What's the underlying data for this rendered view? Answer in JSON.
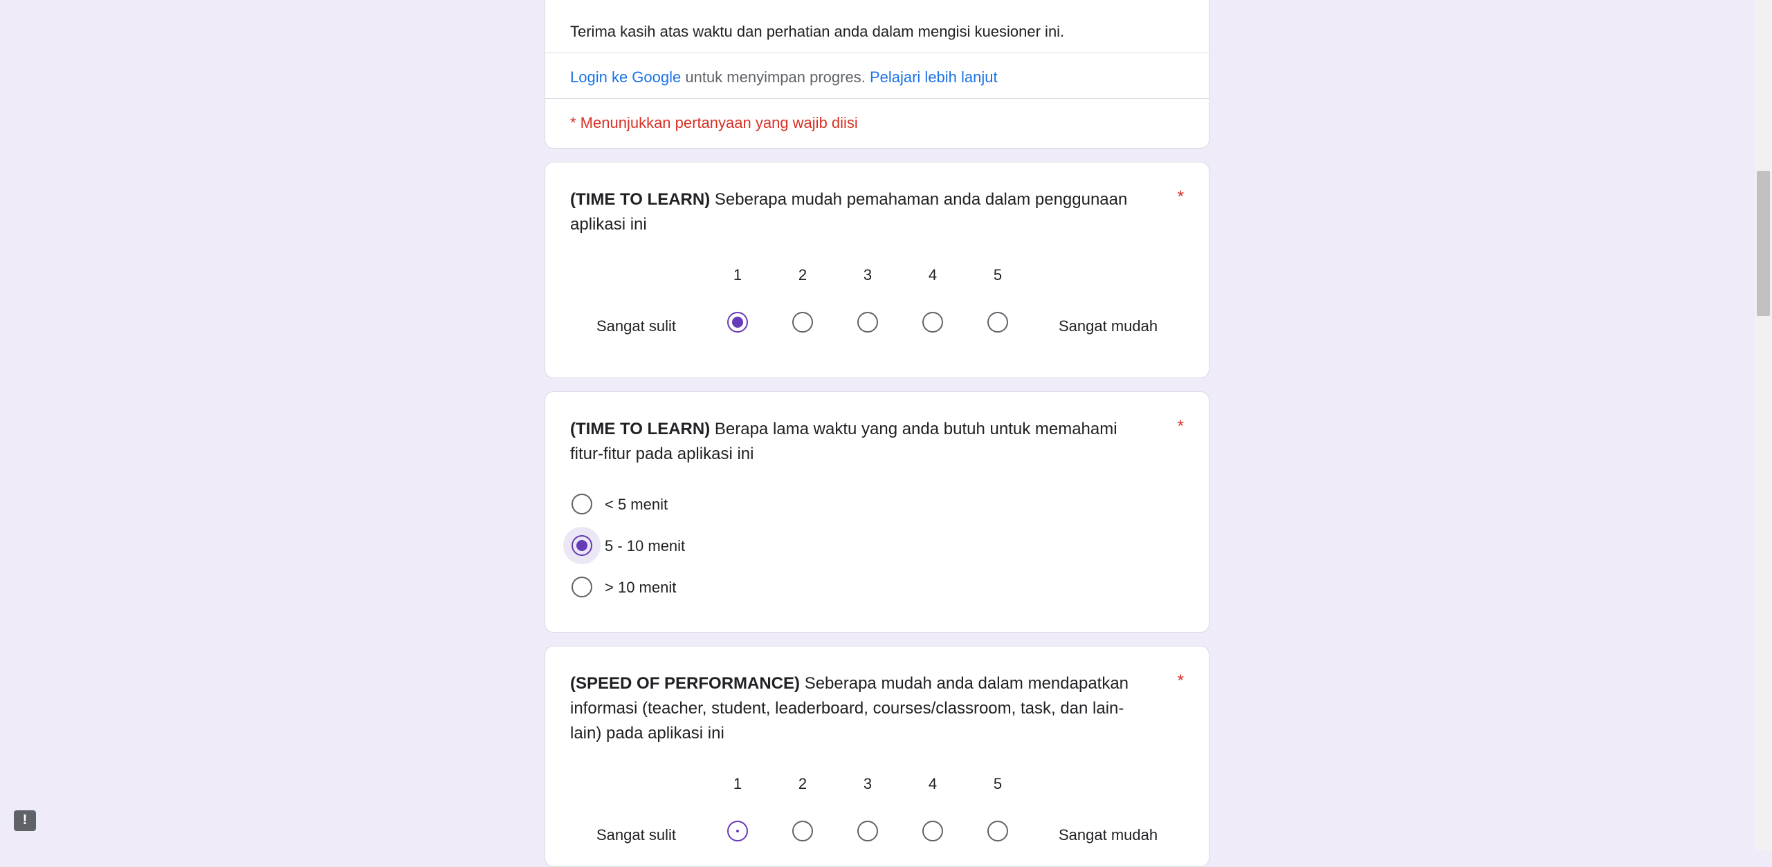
{
  "intro": {
    "thanks_text": "Terima kasih atas waktu dan perhatian anda dalam mengisi kuesioner ini.",
    "login_link": "Login ke Google",
    "login_suffix": "untuk menyimpan progres.",
    "learn_more_link": "Pelajari lebih lanjut",
    "required_note": "* Menunjukkan pertanyaan yang wajib diisi"
  },
  "questions": [
    {
      "tag": "(TIME TO LEARN)",
      "text": "Seberapa mudah pemahaman anda dalam penggunaan aplikasi ini",
      "required_mark": "*",
      "type": "linear-scale",
      "scale": [
        "1",
        "2",
        "3",
        "4",
        "5"
      ],
      "low_label": "Sangat sulit",
      "high_label": "Sangat mudah",
      "selected": "1"
    },
    {
      "tag": "(TIME TO LEARN)",
      "text": "Berapa lama waktu yang anda butuh untuk memahami fitur-fitur pada aplikasi ini",
      "required_mark": "*",
      "type": "multiple-choice",
      "options": [
        "< 5 menit",
        "5 - 10 menit",
        "> 10 menit"
      ],
      "selected": "5 - 10 menit"
    },
    {
      "tag": "(SPEED OF PERFORMANCE)",
      "text": "Seberapa mudah anda dalam mendapatkan informasi (teacher, student, leaderboard, courses/classroom, task, dan lain-lain) pada aplikasi ini",
      "required_mark": "*",
      "type": "linear-scale",
      "scale": [
        "1",
        "2",
        "3",
        "4",
        "5"
      ],
      "low_label": "Sangat sulit",
      "high_label": "Sangat mudah",
      "selected": null
    }
  ],
  "icons": {
    "feedback": "feedback-icon",
    "feedback_glyph": "!"
  },
  "colors": {
    "background": "#f0ebf8",
    "accent": "#673ab7",
    "link": "#1a73e8",
    "required": "#d93025"
  }
}
